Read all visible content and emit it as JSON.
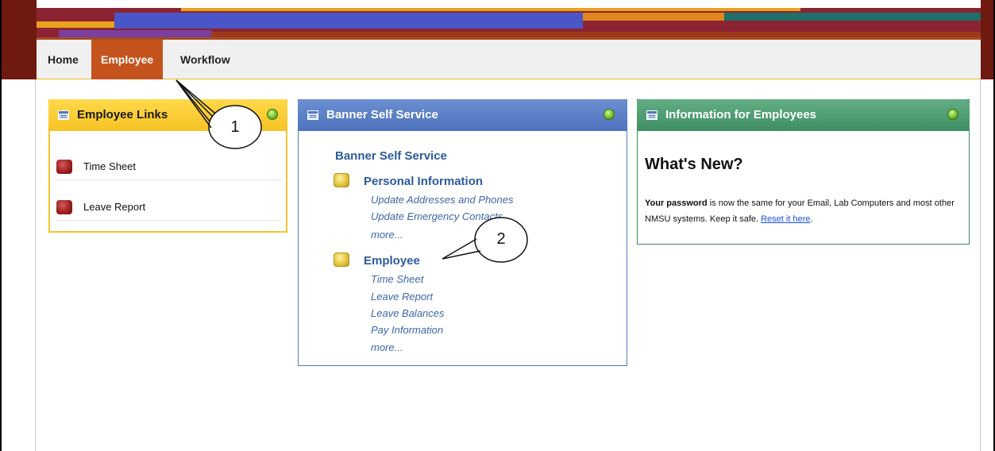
{
  "nav": {
    "items": [
      {
        "label": "Home",
        "active": false
      },
      {
        "label": "Employee",
        "active": true
      },
      {
        "label": "Workflow",
        "active": false
      }
    ],
    "active_color": "#c4531e"
  },
  "employee_links": {
    "title": "Employee Links",
    "header_color": "#f7c324",
    "items": [
      {
        "label": "Time Sheet",
        "icon": "red-square-icon"
      },
      {
        "label": "Leave Report",
        "icon": "red-square-icon"
      }
    ]
  },
  "banner_self_service": {
    "title": "Banner Self Service",
    "header_color": "#4f73bd",
    "heading": "Banner Self Service",
    "sections": [
      {
        "title": "Personal Information",
        "icon": "yellow-square-icon",
        "links": [
          "Update Addresses and Phones",
          "Update Emergency Contacts",
          "more..."
        ]
      },
      {
        "title": "Employee",
        "icon": "yellow-square-icon",
        "links": [
          "Time Sheet",
          "Leave Report",
          "Leave Balances",
          "Pay Information",
          "more..."
        ]
      }
    ]
  },
  "info_for_employees": {
    "title": "Information for Employees",
    "header_color": "#3f8f63",
    "heading": "What's New?",
    "body_bold": "Your password",
    "body_text": " is now the same for your Email, Lab Computers and most other NMSU systems. Keep it safe. ",
    "link_text": "Reset it here",
    "body_end": "."
  },
  "callouts": [
    {
      "number": "1"
    },
    {
      "number": "2"
    }
  ]
}
